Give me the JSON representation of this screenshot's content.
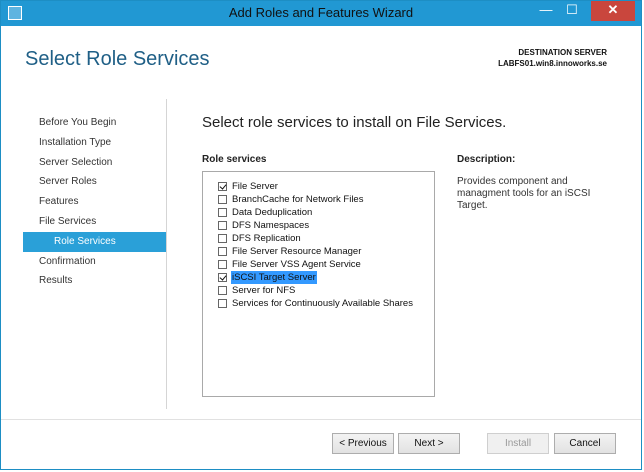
{
  "window": {
    "title": "Add Roles and Features Wizard",
    "minimize_glyph": "—",
    "maximize_glyph": "☐",
    "close_glyph": "✕"
  },
  "header": {
    "page_title": "Select Role Services",
    "destination_label": "DESTINATION SERVER",
    "destination_server": "LABFS01.win8.innoworks.se"
  },
  "nav": {
    "items": [
      {
        "label": "Before You Begin",
        "active": false
      },
      {
        "label": "Installation Type",
        "active": false
      },
      {
        "label": "Server Selection",
        "active": false
      },
      {
        "label": "Server Roles",
        "active": false
      },
      {
        "label": "Features",
        "active": false
      },
      {
        "label": "File Services",
        "active": false
      },
      {
        "label": "Role Services",
        "active": true
      },
      {
        "label": "Confirmation",
        "active": false
      },
      {
        "label": "Results",
        "active": false
      }
    ]
  },
  "main": {
    "heading": "Select role services to install on File Services.",
    "role_services_label": "Role services",
    "description_label": "Description:",
    "description_text": "Provides component and managment tools for an iSCSI Target."
  },
  "role_services": [
    {
      "label": "File Server",
      "checked": true,
      "selected": false
    },
    {
      "label": "BranchCache for Network Files",
      "checked": false,
      "selected": false
    },
    {
      "label": "Data Deduplication",
      "checked": false,
      "selected": false
    },
    {
      "label": "DFS Namespaces",
      "checked": false,
      "selected": false
    },
    {
      "label": "DFS Replication",
      "checked": false,
      "selected": false
    },
    {
      "label": "File Server Resource Manager",
      "checked": false,
      "selected": false
    },
    {
      "label": "File Server VSS Agent Service",
      "checked": false,
      "selected": false
    },
    {
      "label": "iSCSI Target Server",
      "checked": true,
      "selected": true
    },
    {
      "label": "Server for NFS",
      "checked": false,
      "selected": false
    },
    {
      "label": "Services for Continuously Available Shares",
      "checked": false,
      "selected": false
    }
  ],
  "buttons": {
    "previous": "< Previous",
    "next": "Next >",
    "install": "Install",
    "cancel": "Cancel"
  },
  "colors": {
    "titlebar": "#2198d3",
    "accent": "#2aa0d8",
    "close": "#c9463d",
    "selection": "#3399ff"
  }
}
